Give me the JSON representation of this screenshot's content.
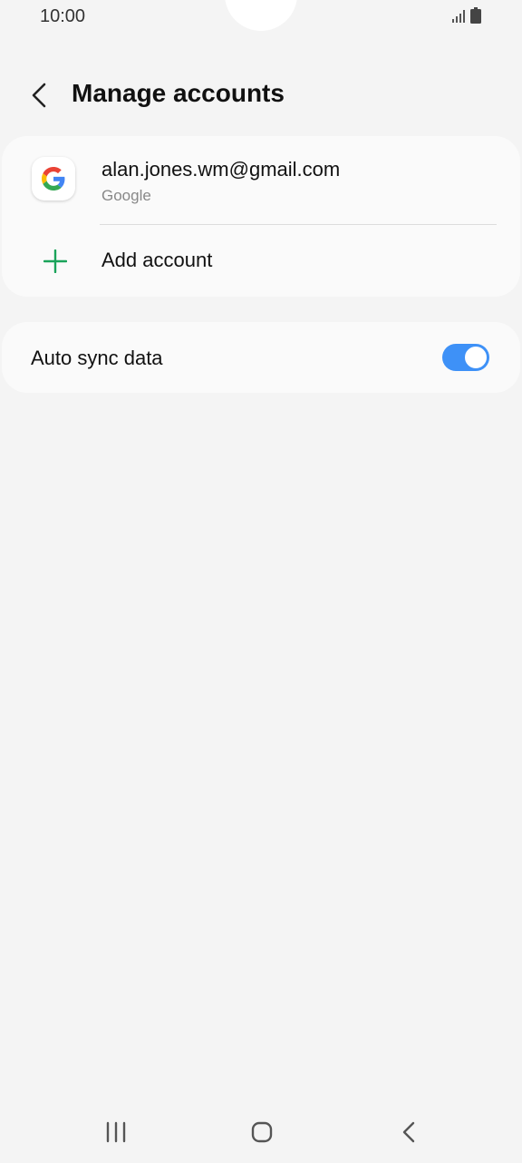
{
  "status_bar": {
    "time": "10:00",
    "icons": [
      "signal-icon",
      "battery-icon"
    ]
  },
  "header": {
    "back_icon": "chevron-left-icon",
    "title": "Manage accounts"
  },
  "accounts": [
    {
      "email": "alan.jones.wm@gmail.com",
      "type": "Google",
      "icon": "google-icon"
    }
  ],
  "add_account": {
    "label": "Add account",
    "icon": "plus-icon",
    "color": "#1aa35a"
  },
  "auto_sync": {
    "label": "Auto sync data",
    "enabled": true,
    "accent": "#3e91f7"
  },
  "nav_bar": {
    "icons": [
      "recents-icon",
      "home-icon",
      "back-icon"
    ]
  }
}
